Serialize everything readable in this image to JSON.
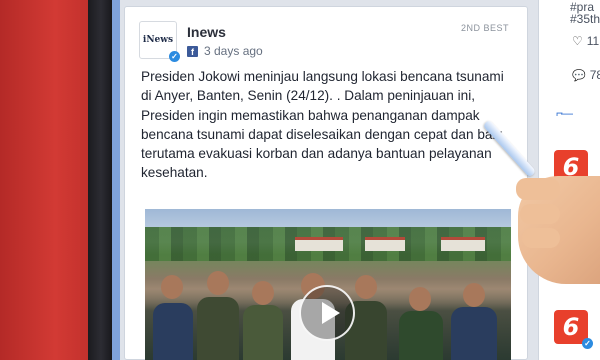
{
  "post": {
    "author": "Inews",
    "logo_text": "iNews",
    "timestamp": "3 days ago",
    "badge": "2ND BEST",
    "caption": "Presiden Jokowi meninjau langsung lokasi bencana tsunami di Anyer, Banten, Senin (24/12). . Dalam peninjauan ini, Presiden ingin memastikan bahwa penanganan dampak bencana tsunami dapat diselesaikan dengan cepat dan baik, terutama evakuasi korban dan adanya bantuan pelayanan kesehatan.",
    "verified_mark": "✓",
    "facebook_glyph": "f"
  },
  "side": {
    "tag_line_1": "#pra",
    "tag_line_2": "#35th",
    "likes": "11",
    "comments": "78",
    "line_glyph": "⌐—",
    "six_label": "6",
    "six_check": "✓"
  },
  "icons": {
    "heart": "♡",
    "comment": "💬",
    "play": "play-icon"
  },
  "colors": {
    "red_wall": "#c8322e",
    "brand_red": "#e8402c",
    "verified_blue": "#2c8be0",
    "facebook_blue": "#3c5a99"
  }
}
